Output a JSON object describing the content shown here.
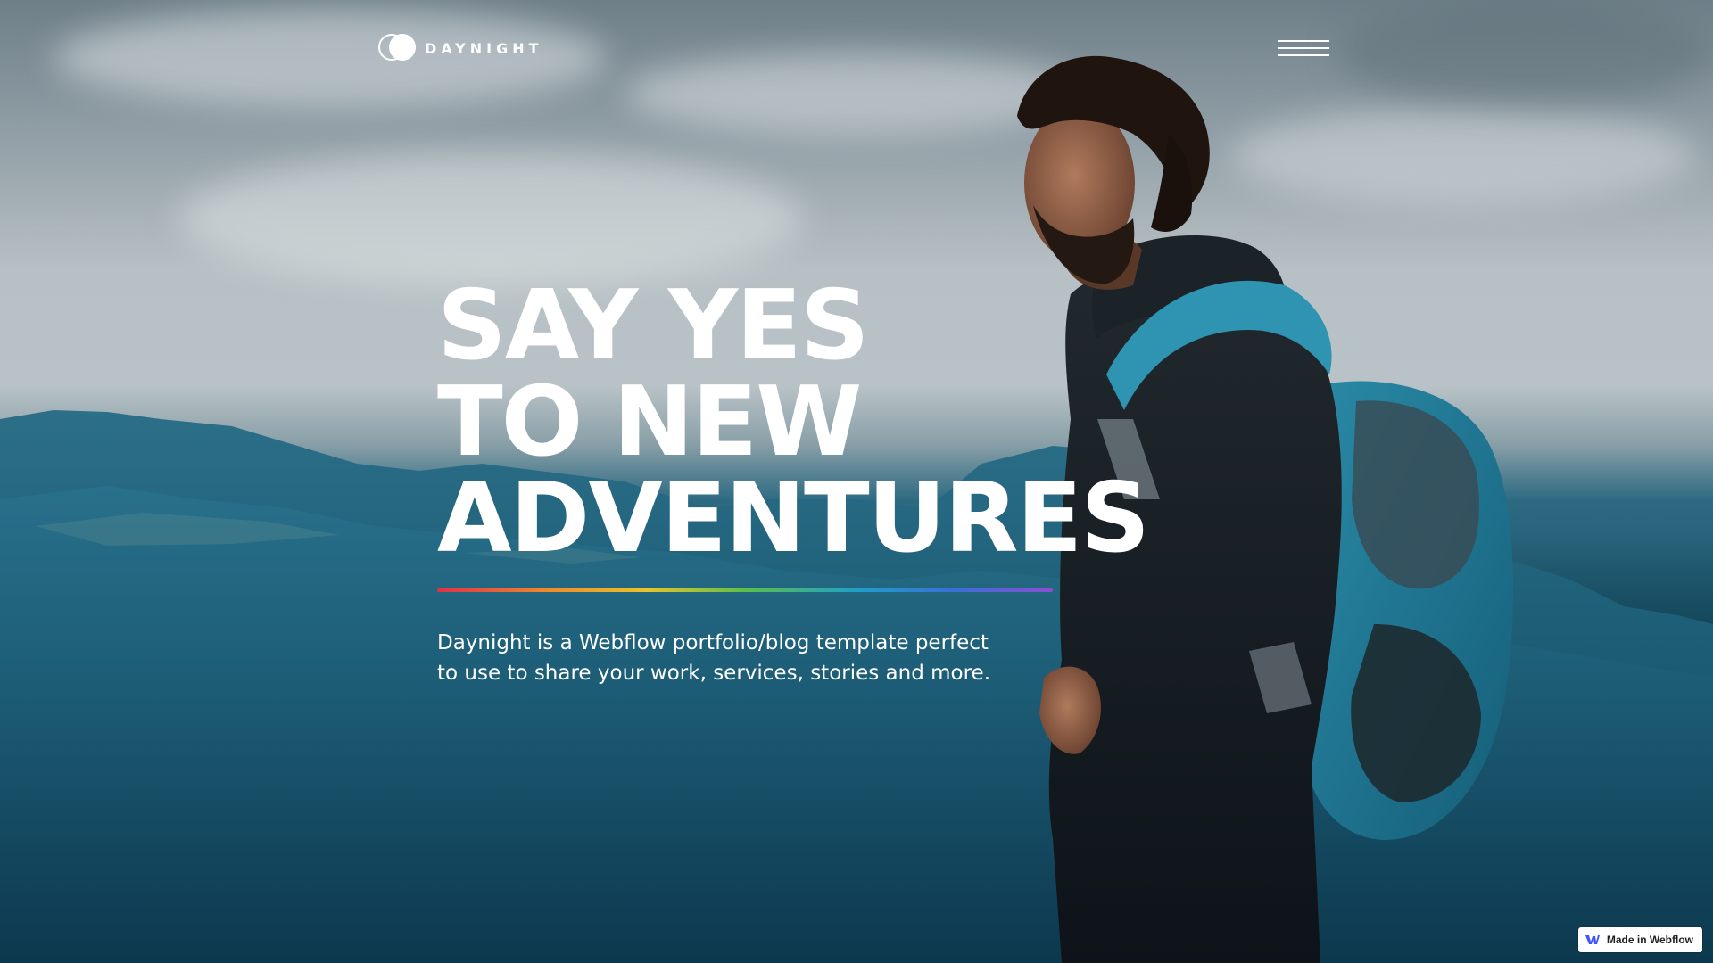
{
  "brand": {
    "name": "DAYNIGHT",
    "logo_icon": "day-night-circles-icon"
  },
  "nav": {
    "menu_icon": "hamburger-menu-icon"
  },
  "hero": {
    "headline_lines": [
      "SAY YES",
      "TO NEW",
      "ADVENTURES"
    ],
    "tagline": "Daynight is a Webflow portfolio/blog template perfect to use to share your work, services, stories and more.",
    "rule_colors": [
      "#e0304a",
      "#f08a2a",
      "#e8c42a",
      "#5cbf4a",
      "#1fa0c8",
      "#3a6fd8",
      "#8a4fd0"
    ]
  },
  "badge": {
    "label": "Made in Webflow",
    "icon": "webflow-logo-icon",
    "accent": "#4353ff"
  }
}
